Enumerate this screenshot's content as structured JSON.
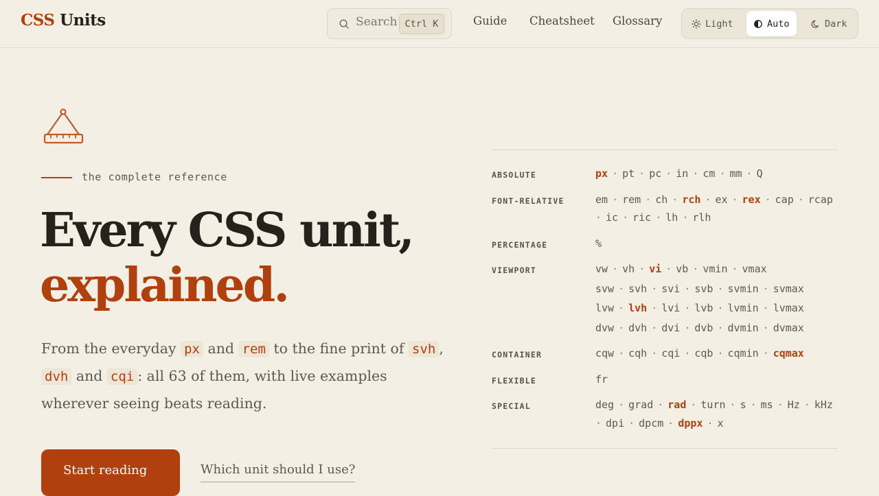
{
  "header": {
    "logo_accent": "CSS",
    "logo_rest": "Units",
    "search": {
      "placeholder": "Search",
      "shortcut": "Ctrl K",
      "icon": "search-icon"
    },
    "nav": [
      "Guide",
      "Cheatsheet",
      "Glossary"
    ],
    "theme": {
      "options": [
        {
          "label": "Light",
          "icon": "sun-icon"
        },
        {
          "label": "Auto",
          "icon": "half-circle-icon"
        },
        {
          "label": "Dark",
          "icon": "moon-icon"
        }
      ],
      "selected": "Auto"
    }
  },
  "hero": {
    "eyebrow": "the complete reference",
    "headline_line1": "Every CSS unit,",
    "headline_line2": "explained.",
    "lede": {
      "t1": "From the everyday ",
      "c1": "px",
      "t2": " and ",
      "c2": "rem",
      "t3": " to the fine print of ",
      "c3": "svh",
      "t4": ", ",
      "c4": "dvh",
      "t5": " and ",
      "c5": "cqi",
      "t6": ": all 63 of them, with live examples wherever seeing beats reading."
    },
    "cta_primary": "Start reading",
    "cta_secondary": "Which unit should I use?"
  },
  "colors": {
    "accent": "#b0410f",
    "background": "#f3efe4",
    "text": "#25221c"
  },
  "unit_groups": [
    {
      "category": "ABSOLUTE",
      "rows": [
        [
          {
            "u": "px",
            "hl": true
          },
          {
            "u": "pt"
          },
          {
            "u": "pc"
          },
          {
            "u": "in"
          },
          {
            "u": "cm"
          },
          {
            "u": "mm"
          },
          {
            "u": "Q"
          }
        ]
      ]
    },
    {
      "category": "FONT-RELATIVE",
      "rows": [
        [
          {
            "u": "em"
          },
          {
            "u": "rem"
          },
          {
            "u": "ch"
          },
          {
            "u": "rch",
            "hl": true
          },
          {
            "u": "ex"
          },
          {
            "u": "rex",
            "hl": true
          },
          {
            "u": "cap"
          },
          {
            "u": "rcap"
          }
        ],
        [
          {
            "u": "ic",
            "lead": true
          },
          {
            "u": "ric"
          },
          {
            "u": "lh"
          },
          {
            "u": "rlh"
          }
        ]
      ]
    },
    {
      "category": "PERCENTAGE",
      "rows": [
        [
          {
            "u": "%"
          }
        ]
      ]
    },
    {
      "category": "VIEWPORT",
      "rows": [
        [
          {
            "u": "vw"
          },
          {
            "u": "vh"
          },
          {
            "u": "vi",
            "hl": true
          },
          {
            "u": "vb"
          },
          {
            "u": "vmin"
          },
          {
            "u": "vmax"
          }
        ],
        [
          {
            "u": "svw"
          },
          {
            "u": "svh"
          },
          {
            "u": "svi"
          },
          {
            "u": "svb"
          },
          {
            "u": "svmin"
          },
          {
            "u": "svmax"
          }
        ],
        [
          {
            "u": "lvw"
          },
          {
            "u": "lvh",
            "hl": true
          },
          {
            "u": "lvi"
          },
          {
            "u": "lvb"
          },
          {
            "u": "lvmin"
          },
          {
            "u": "lvmax"
          }
        ],
        [
          {
            "u": "dvw"
          },
          {
            "u": "dvh"
          },
          {
            "u": "dvi"
          },
          {
            "u": "dvb"
          },
          {
            "u": "dvmin"
          },
          {
            "u": "dvmax"
          }
        ]
      ]
    },
    {
      "category": "CONTAINER",
      "rows": [
        [
          {
            "u": "cqw"
          },
          {
            "u": "cqh"
          },
          {
            "u": "cqi"
          },
          {
            "u": "cqb"
          },
          {
            "u": "cqmin"
          },
          {
            "u": "cqmax",
            "hl": true
          }
        ]
      ]
    },
    {
      "category": "FLEXIBLE",
      "rows": [
        [
          {
            "u": "fr"
          }
        ]
      ]
    },
    {
      "category": "SPECIAL",
      "rows": [
        [
          {
            "u": "deg"
          },
          {
            "u": "grad"
          },
          {
            "u": "rad",
            "hl": true
          },
          {
            "u": "turn"
          },
          {
            "u": "s"
          },
          {
            "u": "ms"
          },
          {
            "u": "Hz"
          },
          {
            "u": "kHz"
          }
        ],
        [
          {
            "u": "dpi",
            "lead": true
          },
          {
            "u": "dpcm"
          },
          {
            "u": "dppx",
            "hl": true
          },
          {
            "u": "x"
          }
        ]
      ]
    }
  ]
}
